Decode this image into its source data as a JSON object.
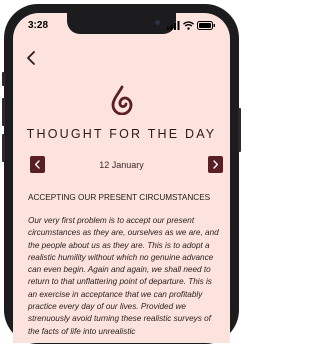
{
  "status_bar": {
    "time": "3:28"
  },
  "header": {
    "back_icon": "chevron-left-icon"
  },
  "logo": {
    "icon": "drop-swirl-logo-icon",
    "color": "#5a1e25"
  },
  "page": {
    "title": "THOUGHT FOR THE DAY",
    "date": "12 January",
    "prev_icon": "chevron-left-icon",
    "next_icon": "chevron-right-icon",
    "subheading": "ACCEPTING OUR PRESENT CIRCUMSTANCES",
    "body": "Our very first problem is to accept our present circumstances as they are, ourselves as we are, and the people about us as they are. This is to adopt a realistic humility without which no genuine advance can even begin. Again and again, we shall need to return to that unflattering point of departure. This is an exercise in acceptance that we can profitably practice every day of our lives. Provided we strenuously avoid turning these realistic surveys of the facts of life into unrealistic"
  },
  "colors": {
    "background": "#fde3de",
    "accent": "#5a1e25",
    "text": "#2b1b1d"
  }
}
